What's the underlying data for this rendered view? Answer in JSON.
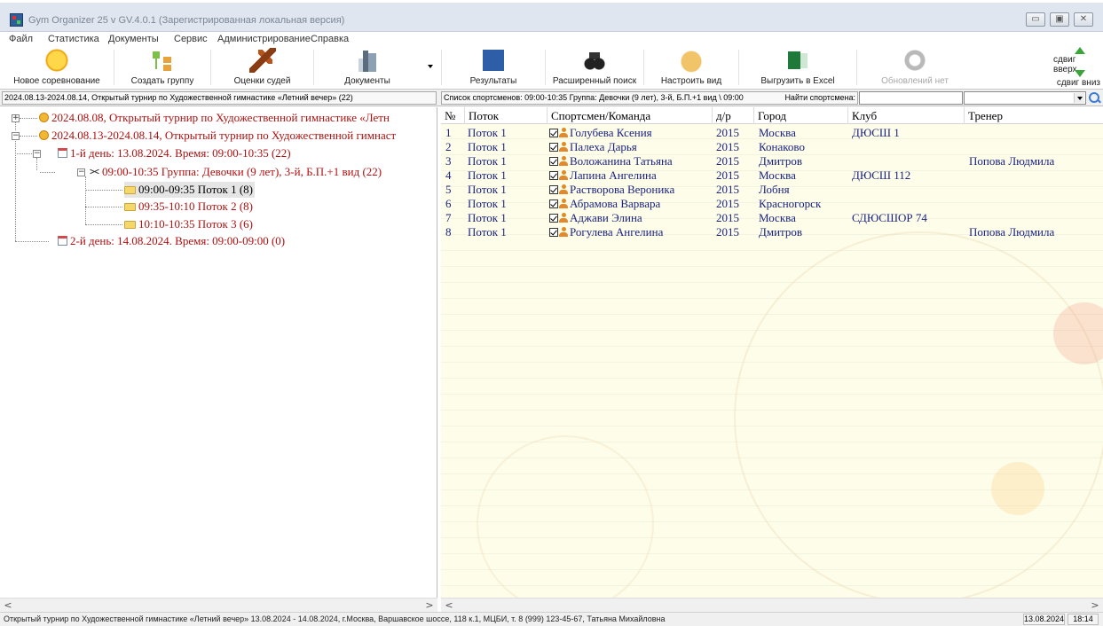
{
  "window": {
    "title": "Gym Organizer 25 v GV.4.0.1 (Зарегистрированная локальная версия)",
    "minimize_icon": "minimize-icon",
    "maximize_icon": "maximize-icon",
    "close_icon": "close-icon"
  },
  "menu": [
    "Файл",
    "Статистика",
    "Документы",
    "Сервис",
    "Администрирование",
    "Справка"
  ],
  "toolbar": {
    "new_competition": "Новое соревнование",
    "create_group": "Создать группу",
    "judge_scores": "Оценки судей",
    "documents": "Документы",
    "results": "Результаты",
    "advanced_search": "Расширенный поиск",
    "customize_view": "Настроить вид",
    "export_excel": "Выгрузить в Excel",
    "updates": "Обновлений нет",
    "shift_up": "сдвиг вверх",
    "shift_down": "сдвиг вниз"
  },
  "context": {
    "left": "2024.08.13-2024.08.14, Открытый турнир по Художественной гимнастике «Летний вечер» (22)",
    "right": "Список спортсменов: 09:00-10:35 Группа: Девочки (9 лет), 3-й, Б.П.+1 вид \\ 09:00",
    "search_label": "Найти спортсмена:",
    "search_value": ""
  },
  "tree": {
    "nodes": [
      {
        "label": "2024.08.08, Открытый турнир по Художественной гимнастике «Летн",
        "icon": "bulb-icon"
      },
      {
        "label": "2024.08.13-2024.08.14, Открытый турнир по Художественной гимнаст",
        "icon": "bulb-icon"
      },
      {
        "label": "1-й день: 13.08.2024. Время: 09:00-10:35 (22)",
        "icon": "calendar-icon"
      },
      {
        "label": "09:00-10:35 Группа: Девочки (9 лет), 3-й, Б.П.+1 вид (22)",
        "icon": "ribbon-icon"
      },
      {
        "label": "09:00-09:35 Поток 1 (8)",
        "icon": "folder-icon"
      },
      {
        "label": "09:35-10:10 Поток 2 (8)",
        "icon": "folder-icon"
      },
      {
        "label": "10:10-10:35 Поток 3 (6)",
        "icon": "folder-icon"
      },
      {
        "label": "2-й день: 14.08.2024. Время: 09:00-09:00 (0)",
        "icon": "calendar-icon"
      }
    ],
    "expander_plus": "+",
    "expander_minus": "−"
  },
  "grid": {
    "columns": [
      "№",
      "Поток",
      "Спортсмен/Команда",
      "д/р",
      "Город",
      "Клуб",
      "Тренер"
    ],
    "rows": [
      {
        "n": "1",
        "flow": "Поток 1",
        "name": "Голубева Ксения",
        "year": "2015",
        "city": "Москва",
        "club": "ДЮСШ 1",
        "coach": ""
      },
      {
        "n": "2",
        "flow": "Поток 1",
        "name": "Палеха Дарья",
        "year": "2015",
        "city": "Конаково",
        "club": "",
        "coach": ""
      },
      {
        "n": "3",
        "flow": "Поток 1",
        "name": "Воложанина Татьяна",
        "year": "2015",
        "city": "Дмитров",
        "club": "",
        "coach": "Попова Людмила"
      },
      {
        "n": "4",
        "flow": "Поток 1",
        "name": "Лапина Ангелина",
        "year": "2015",
        "city": "Москва",
        "club": "ДЮСШ 112",
        "coach": ""
      },
      {
        "n": "5",
        "flow": "Поток 1",
        "name": "Растворова Вероника",
        "year": "2015",
        "city": "Лобня",
        "club": "",
        "coach": ""
      },
      {
        "n": "6",
        "flow": "Поток 1",
        "name": "Абрамова Варвара",
        "year": "2015",
        "city": "Красногорск",
        "club": "",
        "coach": ""
      },
      {
        "n": "7",
        "flow": "Поток 1",
        "name": "Аджави Элина",
        "year": "2015",
        "city": "Москва",
        "club": "СДЮСШОР 74",
        "coach": ""
      },
      {
        "n": "8",
        "flow": "Поток 1",
        "name": "Рогулева Ангелина",
        "year": "2015",
        "city": "Дмитров",
        "club": "",
        "coach": "Попова Людмила"
      }
    ]
  },
  "scroll": {
    "left": "<",
    "right": ">"
  },
  "status": {
    "info": "Открытый турнир по Художественной гимнастике «Летний вечер» 13.08.2024 - 14.08.2024, г.Москва, Варшавское шоссе, 118 к.1, МЦБИ, т. 8 (999) 123-45-67, Татьяна Михайловна",
    "date": "13.08.2024",
    "time": "18:14"
  }
}
